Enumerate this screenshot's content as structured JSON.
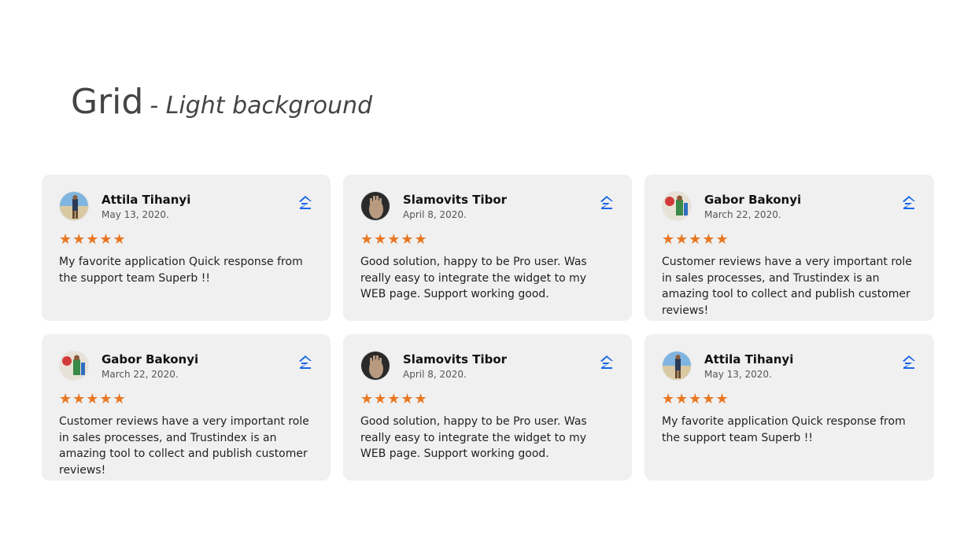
{
  "heading": {
    "title": "Grid",
    "subtitle": "- Light background"
  },
  "colors": {
    "card_bg": "#f0f0f0",
    "star": "#e87722",
    "platform_icon": "#1a66e8"
  },
  "reviews": [
    {
      "name": "Attila Tihanyi",
      "date": "May 13, 2020.",
      "rating": 5,
      "stars": "★★★★★",
      "avatar": "beach-avatar",
      "platform_icon": "zillow-icon",
      "text": "My favorite application Quick response from the support team Superb !!"
    },
    {
      "name": "Slamovits Tibor",
      "date": "April 8, 2020.",
      "rating": 5,
      "stars": "★★★★★",
      "avatar": "hand-avatar",
      "platform_icon": "zillow-icon",
      "text": "Good solution, happy to be Pro user. Was really easy to integrate the widget to my WEB page. Support working good."
    },
    {
      "name": "Gabor Bakonyi",
      "date": "March 22, 2020.",
      "rating": 5,
      "stars": "★★★★★",
      "avatar": "outdoor-avatar",
      "platform_icon": "zillow-icon",
      "text": "Customer reviews have a very important role in sales processes, and Trustindex is an amazing tool to collect and publish customer reviews!"
    },
    {
      "name": "Gabor Bakonyi",
      "date": "March 22, 2020.",
      "rating": 5,
      "stars": "★★★★★",
      "avatar": "outdoor-avatar",
      "platform_icon": "zillow-icon",
      "text": "Customer reviews have a very important role in sales processes, and Trustindex is an amazing tool to collect and publish customer reviews!"
    },
    {
      "name": "Slamovits Tibor",
      "date": "April 8, 2020.",
      "rating": 5,
      "stars": "★★★★★",
      "avatar": "hand-avatar",
      "platform_icon": "zillow-icon",
      "text": "Good solution, happy to be Pro user. Was really easy to integrate the widget to my WEB page. Support working good."
    },
    {
      "name": "Attila Tihanyi",
      "date": "May 13, 2020.",
      "rating": 5,
      "stars": "★★★★★",
      "avatar": "beach-avatar",
      "platform_icon": "zillow-icon",
      "text": "My favorite application Quick response from the support team Superb !!"
    }
  ]
}
